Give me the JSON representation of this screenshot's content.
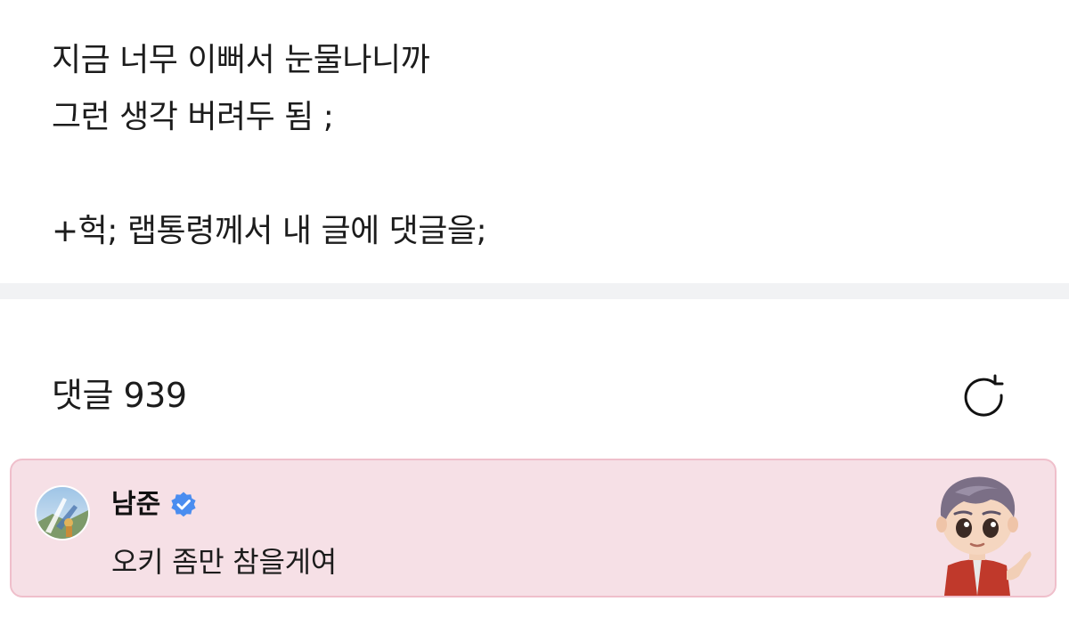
{
  "post": {
    "lines": [
      "지금 너무 이뻐서 눈물나니까",
      "그런 생각 버려두 됨 ;",
      "",
      "+헉; 랩통령께서 내 글에 댓글을;"
    ]
  },
  "comments": {
    "title": "댓글 939",
    "refresh_icon": "refresh-icon"
  },
  "comment": {
    "author": "남준",
    "verified_icon": "verified-badge-icon",
    "text": "오키 좀만 참을게여",
    "sticker": "character-sticker",
    "colors": {
      "card_background": "#f6e0e6",
      "card_border": "#efbfcb",
      "verified_blue": "#4a8df0"
    }
  }
}
